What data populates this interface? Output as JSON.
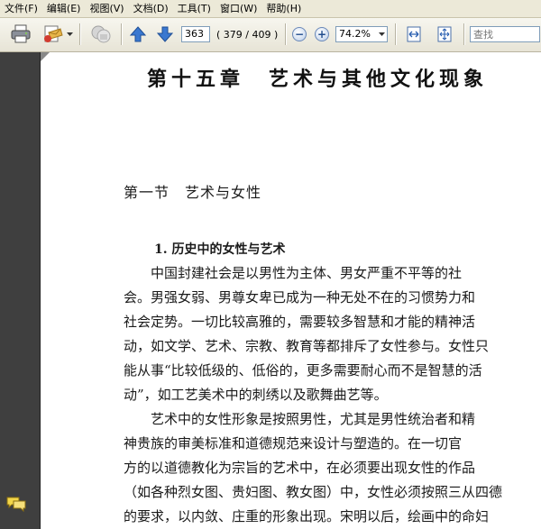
{
  "menu": {
    "items": [
      "文件(F)",
      "编辑(E)",
      "视图(V)",
      "文档(D)",
      "工具(T)",
      "窗口(W)",
      "帮助(H)"
    ]
  },
  "toolbar": {
    "page_number": "363",
    "page_count": "( 379 / 409 )",
    "zoom_value": "74.2%",
    "search_placeholder": "查找"
  },
  "icons": {
    "print": "printer-icon",
    "email": "email-icon",
    "email_menu": "chevron-down-icon",
    "lock": "security-icon",
    "prev": "arrow-up-icon",
    "next": "arrow-down-icon",
    "zoom_out": "minus-icon",
    "zoom_in": "plus-icon",
    "fit_width": "fit-width-icon",
    "fit_page": "fit-page-icon",
    "comments": "comment-icon"
  },
  "colors": {
    "menubar_bg": "#ece9d8",
    "navpanel_bg": "#3f3f3f",
    "nav_arrow": "#3a78d0"
  },
  "document": {
    "chapter_title": "第十五章　艺术与其他文化现象",
    "section_title": "第一节　艺术与女性",
    "subsection_title": "1. 历史中的女性与艺术",
    "paragraph1": [
      "　　中国封建社会是以男性为主体、男女严重不平等的社",
      "会。男强女弱、男尊女卑已成为一种无处不在的习惯势力和",
      "社会定势。一切比较高雅的，需要较多智慧和才能的精神活",
      "动，如文学、艺术、宗教、教育等都排斥了女性参与。女性只",
      "能从事“比较低级的、低俗的，更多需要耐心而不是智慧的活",
      "动”，如工艺美术中的刺绣以及歌舞曲艺等。"
    ],
    "paragraph2": [
      "　　艺术中的女性形象是按照男性，尤其是男性统治者和精",
      "神贵族的审美标准和道德规范来设计与塑造的。在一切官",
      "方的以道德教化为宗旨的艺术中，在必须要出现女性的作品",
      "（如各种烈女图、贵妇图、教女图）中，女性必须按照三从四德",
      "的要求，以内敛、庄重的形象出现。宋明以后，绘画中的命妇"
    ]
  }
}
